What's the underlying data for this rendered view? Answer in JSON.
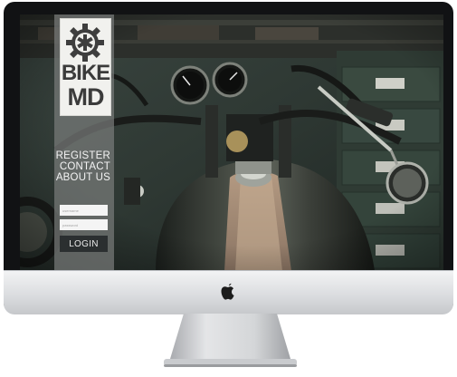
{
  "site": {
    "logo": {
      "line1": "BIKE",
      "line2": "MD",
      "icon": "gear-medical-cross-icon"
    },
    "nav": [
      "REGISTER",
      "CONTACT",
      "ABOUT US"
    ],
    "login_form": {
      "username_placeholder": "username",
      "password_placeholder": "password",
      "button_label": "LOGIN"
    },
    "background": "vintage motorcycle in a garage"
  },
  "device": {
    "brand_icon": "apple-logo-icon"
  },
  "colors": {
    "sidebar": "#787c7a",
    "logo_bg": "#f1f1ee",
    "login_button": "#2b2f30",
    "monitor_bezel": "#111214",
    "monitor_chin": "#d9dbde"
  }
}
